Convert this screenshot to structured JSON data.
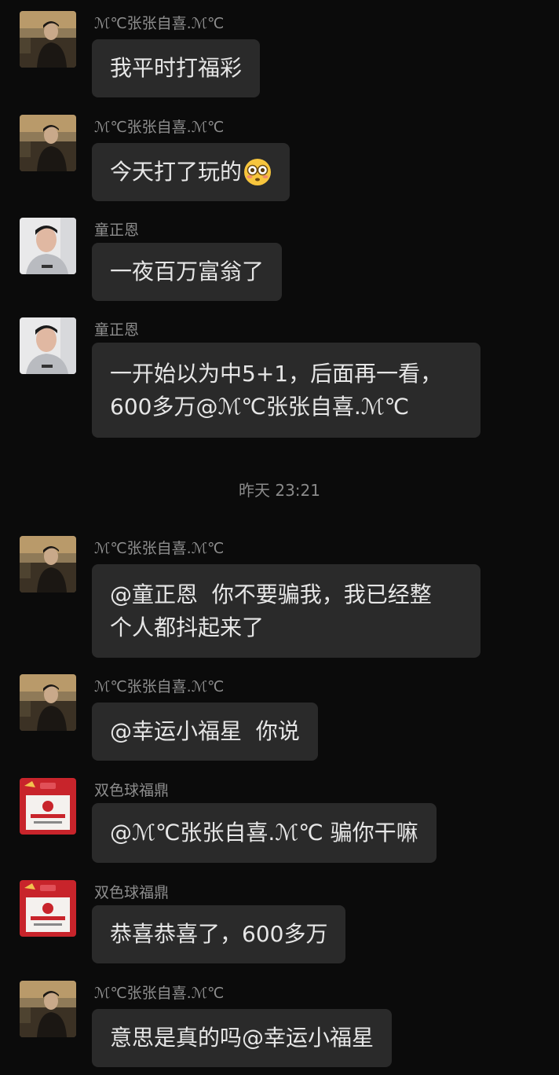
{
  "messages": [
    {
      "sender": "ℳ℃张张自喜.ℳ℃",
      "avatar": "young-man-sunset-avatar",
      "text": "我平时打福彩"
    },
    {
      "sender": "ℳ℃张张自喜.ℳ℃",
      "avatar": "young-man-sunset-avatar",
      "text": "今天打了玩的",
      "emoji": "flushed-face-emoji"
    },
    {
      "sender": "童正恩",
      "avatar": "man-portrait-avatar",
      "text": "一夜百万富翁了"
    },
    {
      "sender": "童正恩",
      "avatar": "man-portrait-avatar",
      "text": "一开始以为中5+1，后面再一看，\n600多万@ℳ℃张张自喜.ℳ℃"
    },
    {
      "sender": "ℳ℃张张自喜.ℳ℃",
      "avatar": "young-man-sunset-avatar",
      "text": "@童正恩  你不要骗我，我已经整\n个人都抖起来了"
    },
    {
      "sender": "ℳ℃张张自喜.ℳ℃",
      "avatar": "young-man-sunset-avatar",
      "text": "@幸运小福星  你说"
    },
    {
      "sender": "双色球福鼎",
      "avatar": "lottery-store-avatar",
      "text": "@ℳ℃张张自喜.ℳ℃ 骗你干嘛"
    },
    {
      "sender": "双色球福鼎",
      "avatar": "lottery-store-avatar",
      "text": "恭喜恭喜了，600多万"
    },
    {
      "sender": "ℳ℃张张自喜.ℳ℃",
      "avatar": "young-man-sunset-avatar",
      "text": "意思是真的吗@幸运小福星"
    }
  ],
  "timestamp": "昨天 23:21",
  "colors": {
    "background": "#0b0b0b",
    "bubble": "#2a2a2a",
    "text": "#e6e6e6",
    "name": "#8d8d8d",
    "lottery_red": "#c8242b"
  }
}
